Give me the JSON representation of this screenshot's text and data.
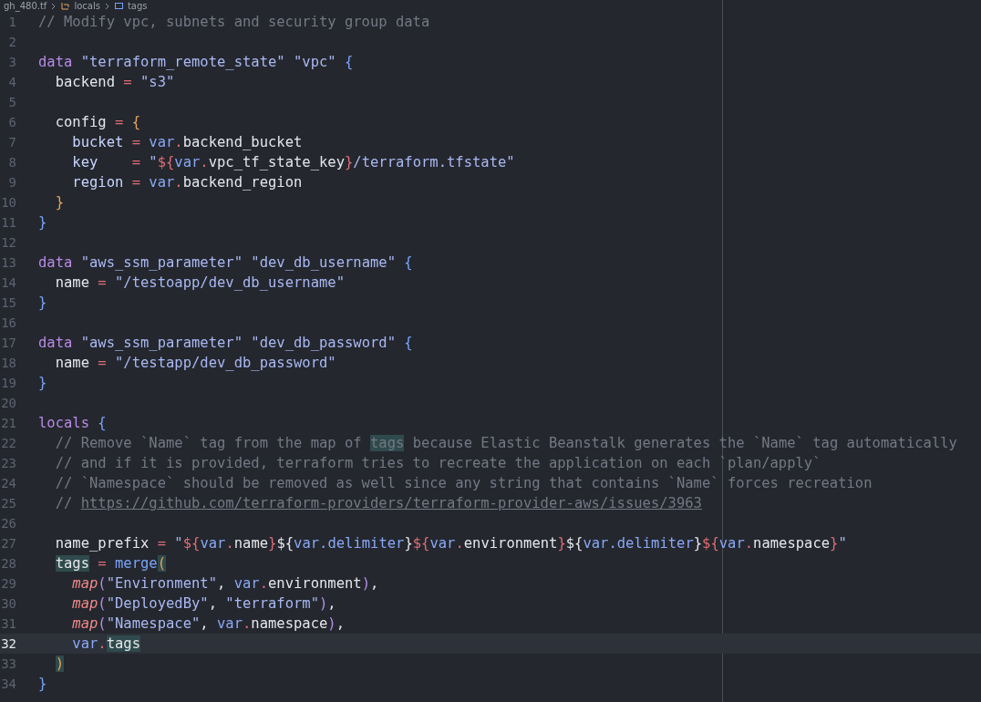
{
  "breadcrumb": [
    {
      "label": "gh_480.tf",
      "kind": "file"
    },
    {
      "label": "locals",
      "kind": "block"
    },
    {
      "label": "tags",
      "kind": "field"
    }
  ],
  "editor": {
    "lines": [
      {
        "number": "1",
        "current": false,
        "tokens": [
          {
            "kind": "comment",
            "text": "// Modify vpc, subnets and security group data"
          }
        ]
      },
      {
        "number": "2",
        "current": false
      },
      {
        "number": "3",
        "current": false,
        "tokens": [
          {
            "kind": "keyword",
            "text": "data"
          },
          {
            "kind": "string",
            "text": " \"terraform_remote_state\""
          },
          {
            "kind": "string",
            "text": " \"vpc\""
          },
          {
            "kind": "brace",
            "text": " {"
          }
        ]
      },
      {
        "number": "4",
        "current": false,
        "tokens": [
          {
            "kind": "plain",
            "text": "  backend"
          },
          {
            "kind": "op",
            "text": " ="
          },
          {
            "kind": "string",
            "text": " \"s3\""
          }
        ]
      },
      {
        "number": "5",
        "current": false
      },
      {
        "number": "6",
        "current": false,
        "tokens": [
          {
            "kind": "plain",
            "text": "  config"
          },
          {
            "kind": "op",
            "text": " ="
          },
          {
            "kind": "brace2",
            "text": " {"
          }
        ]
      },
      {
        "number": "7",
        "current": false,
        "tokens": [
          {
            "kind": "attr",
            "text": "    bucket"
          },
          {
            "kind": "op",
            "text": " ="
          },
          {
            "kind": "var",
            "text": " var"
          },
          {
            "kind": "op",
            "text": "."
          },
          {
            "kind": "plain",
            "text": "backend_bucket"
          }
        ]
      },
      {
        "number": "8",
        "current": false,
        "tokens": [
          {
            "kind": "attr",
            "text": "    key"
          },
          {
            "kind": "op",
            "text": "    ="
          },
          {
            "kind": "string",
            "text": " \""
          },
          {
            "kind": "interp",
            "text": "${"
          },
          {
            "kind": "var",
            "text": "var"
          },
          {
            "kind": "op",
            "text": "."
          },
          {
            "kind": "plain",
            "text": "vpc_tf_state_key"
          },
          {
            "kind": "interp",
            "text": "}"
          },
          {
            "kind": "string",
            "text": "/terraform.tfstate\""
          }
        ]
      },
      {
        "number": "9",
        "current": false,
        "tokens": [
          {
            "kind": "attr",
            "text": "    region"
          },
          {
            "kind": "op",
            "text": " ="
          },
          {
            "kind": "var",
            "text": " var"
          },
          {
            "kind": "op",
            "text": "."
          },
          {
            "kind": "plain",
            "text": "backend_region"
          }
        ]
      },
      {
        "number": "10",
        "current": false,
        "tokens": [
          {
            "kind": "brace2",
            "text": "  }"
          }
        ]
      },
      {
        "number": "11",
        "current": false,
        "tokens": [
          {
            "kind": "brace",
            "text": "}"
          }
        ]
      },
      {
        "number": "12",
        "current": false
      },
      {
        "number": "13",
        "current": false,
        "tokens": [
          {
            "kind": "keyword",
            "text": "data"
          },
          {
            "kind": "string",
            "text": " \"aws_ssm_parameter\""
          },
          {
            "kind": "string",
            "text": " \"dev_db_username\""
          },
          {
            "kind": "brace",
            "text": " {"
          }
        ]
      },
      {
        "number": "14",
        "current": false,
        "tokens": [
          {
            "kind": "plain",
            "text": "  name"
          },
          {
            "kind": "op",
            "text": " ="
          },
          {
            "kind": "string",
            "text": " \"/testoapp/dev_db_username\""
          }
        ]
      },
      {
        "number": "15",
        "current": false,
        "tokens": [
          {
            "kind": "brace",
            "text": "}"
          }
        ]
      },
      {
        "number": "16",
        "current": false
      },
      {
        "number": "17",
        "current": false,
        "tokens": [
          {
            "kind": "keyword",
            "text": "data"
          },
          {
            "kind": "string",
            "text": " \"aws_ssm_parameter\""
          },
          {
            "kind": "string",
            "text": " \"dev_db_password\""
          },
          {
            "kind": "brace",
            "text": " {"
          }
        ]
      },
      {
        "number": "18",
        "current": false,
        "tokens": [
          {
            "kind": "plain",
            "text": "  name"
          },
          {
            "kind": "op",
            "text": " ="
          },
          {
            "kind": "string",
            "text": " \"/testapp/dev_db_password\""
          }
        ]
      },
      {
        "number": "19",
        "current": false,
        "tokens": [
          {
            "kind": "brace",
            "text": "}"
          }
        ]
      },
      {
        "number": "20",
        "current": false
      },
      {
        "number": "21",
        "current": false,
        "tokens": [
          {
            "kind": "keyword",
            "text": "locals"
          },
          {
            "kind": "brace",
            "text": " {"
          }
        ]
      },
      {
        "number": "22",
        "current": false,
        "tokens": [
          {
            "kind": "comment",
            "text": "  // Remove `Name` tag from the map of"
          },
          {
            "kind": "comment-match",
            "text": " tags"
          },
          {
            "kind": "comment",
            "text": " because Elastic Beanstalk generates the `Name` tag automatically"
          }
        ]
      },
      {
        "number": "23",
        "current": false,
        "tokens": [
          {
            "kind": "comment",
            "text": "  // and if it is provided, terraform tries to recreate the application on each `plan/apply`"
          }
        ]
      },
      {
        "number": "24",
        "current": false,
        "tokens": [
          {
            "kind": "comment",
            "text": "  // `Namespace` should be removed as well since any string that contains `Name` forces recreation"
          }
        ]
      },
      {
        "number": "25",
        "current": false,
        "tokens": [
          {
            "kind": "comment",
            "text": "  //"
          },
          {
            "kind": "link",
            "text": " https://github.com/terraform-providers/terraform-provider-aws/issues/3963"
          }
        ]
      },
      {
        "number": "26",
        "current": false
      },
      {
        "number": "27",
        "current": false,
        "tokens": [
          {
            "kind": "plain",
            "text": "  name_prefix"
          },
          {
            "kind": "op",
            "text": " ="
          },
          {
            "kind": "string",
            "text": " \""
          },
          {
            "kind": "interp",
            "text": "${"
          },
          {
            "kind": "var",
            "text": "var"
          },
          {
            "kind": "op",
            "text": "."
          },
          {
            "kind": "plain",
            "text": "name"
          },
          {
            "kind": "interp",
            "text": "}"
          },
          {
            "kind": "plain",
            "text": "${"
          },
          {
            "kind": "var",
            "text": "var.delimiter"
          },
          {
            "kind": "plain",
            "text": "}"
          },
          {
            "kind": "interp",
            "text": "${"
          },
          {
            "kind": "var",
            "text": "var"
          },
          {
            "kind": "op",
            "text": "."
          },
          {
            "kind": "plain",
            "text": "environment"
          },
          {
            "kind": "interp",
            "text": "}"
          },
          {
            "kind": "plain",
            "text": "${"
          },
          {
            "kind": "var",
            "text": "var.delimiter"
          },
          {
            "kind": "plain",
            "text": "}"
          },
          {
            "kind": "interp",
            "text": "${"
          },
          {
            "kind": "var",
            "text": "var"
          },
          {
            "kind": "op",
            "text": "."
          },
          {
            "kind": "plain",
            "text": "namespace"
          },
          {
            "kind": "interp",
            "text": "}"
          },
          {
            "kind": "string",
            "text": "\""
          }
        ]
      },
      {
        "number": "28",
        "current": false,
        "tokens": [
          {
            "kind": "match",
            "text": "  tags"
          },
          {
            "kind": "op",
            "text": " ="
          },
          {
            "kind": "func",
            "text": " merge"
          },
          {
            "kind": "paren-match",
            "text": "("
          }
        ]
      },
      {
        "number": "29",
        "current": false,
        "tokens": [
          {
            "kind": "call",
            "text": "    map"
          },
          {
            "kind": "paren",
            "text": "("
          },
          {
            "kind": "string",
            "text": "\"Environment\""
          },
          {
            "kind": "plain",
            "text": ","
          },
          {
            "kind": "var",
            "text": " var"
          },
          {
            "kind": "op",
            "text": "."
          },
          {
            "kind": "plain",
            "text": "environment"
          },
          {
            "kind": "paren",
            "text": ")"
          },
          {
            "kind": "plain",
            "text": ","
          }
        ]
      },
      {
        "number": "30",
        "current": false,
        "tokens": [
          {
            "kind": "call",
            "text": "    map"
          },
          {
            "kind": "paren",
            "text": "("
          },
          {
            "kind": "string",
            "text": "\"DeployedBy\""
          },
          {
            "kind": "plain",
            "text": ","
          },
          {
            "kind": "string",
            "text": " \"terraform\""
          },
          {
            "kind": "paren",
            "text": ")"
          },
          {
            "kind": "plain",
            "text": ","
          }
        ]
      },
      {
        "number": "31",
        "current": false,
        "tokens": [
          {
            "kind": "call",
            "text": "    map"
          },
          {
            "kind": "paren",
            "text": "("
          },
          {
            "kind": "string",
            "text": "\"Namespace\""
          },
          {
            "kind": "plain",
            "text": ","
          },
          {
            "kind": "var",
            "text": " var"
          },
          {
            "kind": "op",
            "text": "."
          },
          {
            "kind": "plain",
            "text": "namespace"
          },
          {
            "kind": "paren",
            "text": ")"
          },
          {
            "kind": "plain",
            "text": ","
          }
        ]
      },
      {
        "number": "32",
        "current": true,
        "tokens": [
          {
            "kind": "var",
            "text": "    var"
          },
          {
            "kind": "op",
            "text": "."
          },
          {
            "kind": "match",
            "text": "tags"
          }
        ]
      },
      {
        "number": "33",
        "current": false,
        "tokens": [
          {
            "kind": "paren-match",
            "text": "  )"
          }
        ]
      },
      {
        "number": "34",
        "current": false,
        "tokens": [
          {
            "kind": "brace",
            "text": "}"
          }
        ]
      }
    ]
  }
}
